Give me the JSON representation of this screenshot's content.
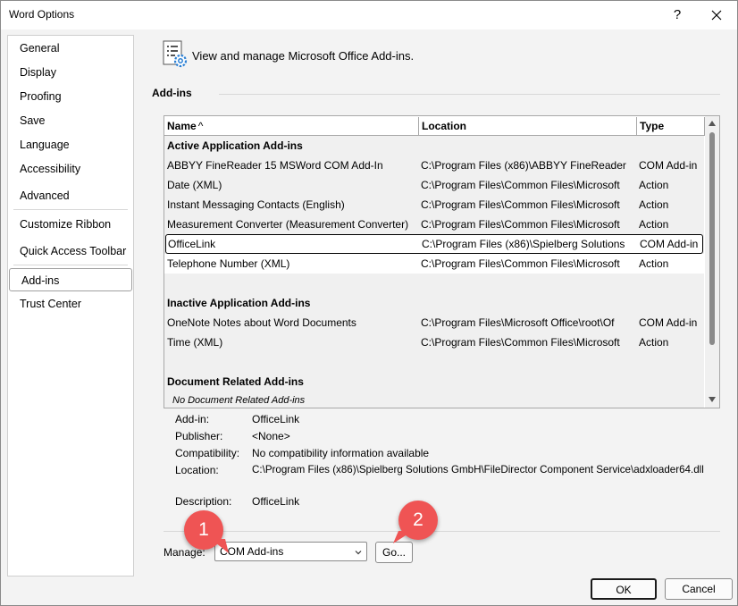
{
  "window": {
    "title": "Word Options",
    "help_glyph": "?",
    "close_glyph": "✕"
  },
  "sidebar": {
    "items": [
      {
        "label": "General"
      },
      {
        "label": "Display"
      },
      {
        "label": "Proofing"
      },
      {
        "label": "Save"
      },
      {
        "label": "Language"
      },
      {
        "label": "Accessibility"
      },
      {
        "label": "Advanced"
      },
      {
        "label": "Customize Ribbon"
      },
      {
        "label": "Quick Access Toolbar"
      },
      {
        "label": "Add-ins",
        "selected": true
      },
      {
        "label": "Trust Center"
      }
    ]
  },
  "header": {
    "text": "View and manage Microsoft Office Add-ins.",
    "icon": "addins-gear-icon"
  },
  "section": {
    "title": "Add-ins"
  },
  "grid": {
    "columns": {
      "name": "Name",
      "sort_indicator": "^",
      "location": "Location",
      "type": "Type"
    },
    "groups": {
      "active": "Active Application Add-ins",
      "inactive": "Inactive Application Add-ins",
      "document": "Document Related Add-ins",
      "document_note": "No Document Related Add-ins"
    },
    "active_rows": [
      {
        "name": "ABBYY FineReader 15 MSWord COM Add-In",
        "location": "C:\\Program Files (x86)\\ABBYY FineReader",
        "type": "COM Add-in"
      },
      {
        "name": "Date (XML)",
        "location": "C:\\Program Files\\Common Files\\Microsoft",
        "type": "Action"
      },
      {
        "name": "Instant Messaging Contacts (English)",
        "location": "C:\\Program Files\\Common Files\\Microsoft",
        "type": "Action"
      },
      {
        "name": "Measurement Converter (Measurement Converter)",
        "location": "C:\\Program Files\\Common Files\\Microsoft",
        "type": "Action"
      },
      {
        "name": "OfficeLink",
        "location": "C:\\Program Files (x86)\\Spielberg Solutions",
        "type": "COM Add-in",
        "selected": true
      },
      {
        "name": "Telephone Number (XML)",
        "location": "C:\\Program Files\\Common Files\\Microsoft",
        "type": "Action"
      }
    ],
    "inactive_rows": [
      {
        "name": "OneNote Notes about Word Documents",
        "location": "C:\\Program Files\\Microsoft Office\\root\\Of",
        "type": "COM Add-in"
      },
      {
        "name": "Time (XML)",
        "location": "C:\\Program Files\\Common Files\\Microsoft",
        "type": "Action"
      }
    ]
  },
  "details": {
    "addin_label": "Add-in:",
    "addin_value": "OfficeLink",
    "publisher_label": "Publisher:",
    "publisher_value": "<None>",
    "compat_label": "Compatibility:",
    "compat_value": "No compatibility information available",
    "location_label": "Location:",
    "location_value": "C:\\Program Files (x86)\\Spielberg Solutions GmbH\\FileDirector Component Service\\adxloader64.dll",
    "description_label": "Description:",
    "description_value": "OfficeLink"
  },
  "manage": {
    "label": "Manage:",
    "selected": "COM Add-ins",
    "go_label": "Go..."
  },
  "footer": {
    "ok_label": "OK",
    "cancel_label": "Cancel"
  },
  "callouts": [
    {
      "number": "1"
    },
    {
      "number": "2"
    }
  ],
  "colors": {
    "callout": "#ef5454",
    "selection_border": "#000000"
  }
}
